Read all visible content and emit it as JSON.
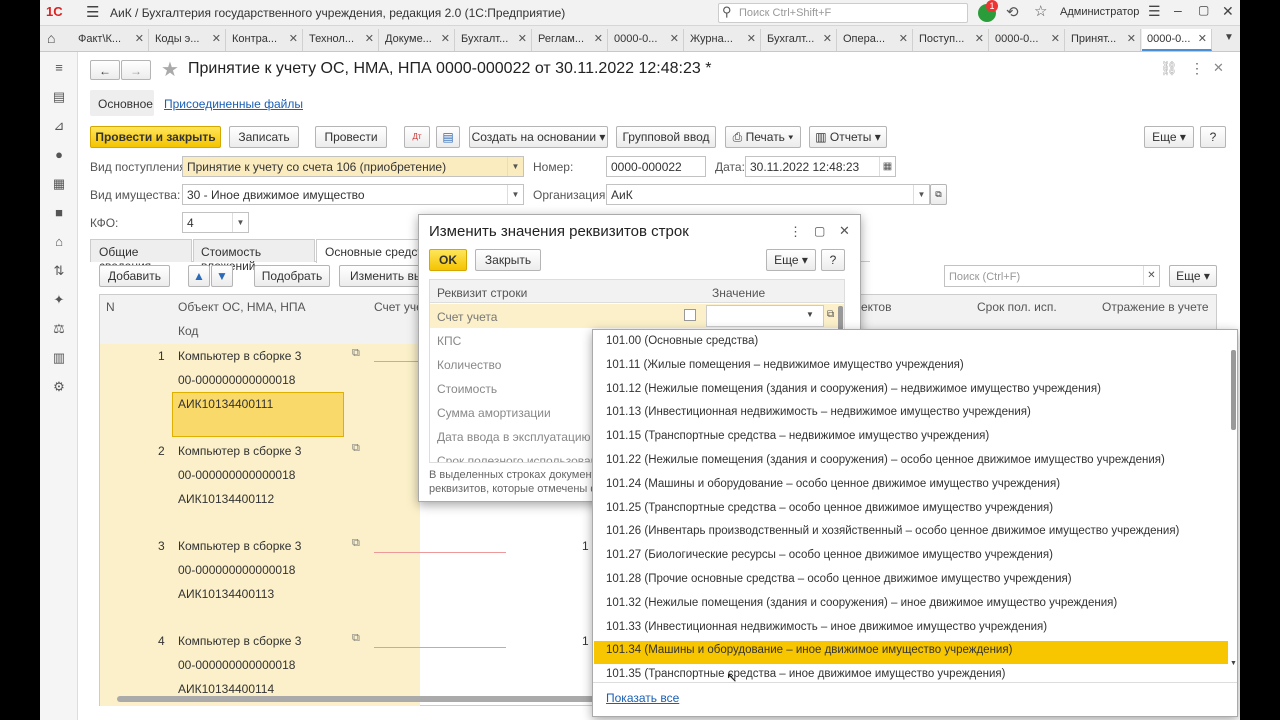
{
  "titlebar": {
    "logo": "1С",
    "menu_icon": "hamburger-icon",
    "title": "АиК / Бухгалтерия государственного учреждения, редакция 2.0  (1С:Предприятие)",
    "search_placeholder": "Поиск Ctrl+Shift+F",
    "notification_count": "1",
    "user": "Администратор"
  },
  "tabs": [
    "Факт\\К...",
    "Коды э...",
    "Контра...",
    "Технол...",
    "Докуме...",
    "Бухгалт...",
    "Реглам...",
    "0000-0...",
    "Журна...",
    "Бухгалт...",
    "Опера...",
    "Поступ...",
    "0000-0...",
    "Принят...",
    "0000-0..."
  ],
  "document": {
    "title": "Принятие к учету ОС, НМА, НПА 0000-000022 от 30.11.2022 12:48:23 *",
    "subtabs": [
      "Основное",
      "Присоединенные файлы"
    ],
    "toolbar": {
      "post_close": "Провести и закрыть",
      "write": "Записать",
      "post": "Провести",
      "create_based": "Создать на основании",
      "group_input": "Групповой ввод",
      "print": "Печать",
      "reports": "Отчеты",
      "more": "Еще",
      "help": "?"
    },
    "fields": {
      "receipt_type_label": "Вид поступления:",
      "receipt_type_value": "Принятие к учету со счета 106 (приобретение)",
      "number_label": "Номер:",
      "number_value": "0000-000022",
      "date_label": "Дата:",
      "date_value": "30.11.2022 12:48:23",
      "property_type_label": "Вид имущества:",
      "property_type_value": "30 - Иное движимое имущество",
      "org_label": "Организация:",
      "org_value": "АиК",
      "kfo_label": "КФО:",
      "kfo_value": "4"
    },
    "sections": [
      "Общие сведения",
      "Стоимость вложений",
      "Основные средства"
    ],
    "grid_toolbar": {
      "add": "Добавить",
      "pick": "Подобрать",
      "change": "Изменить выд",
      "search_placeholder": "Поиск (Ctrl+F)",
      "more": "Еще"
    },
    "grid_headers": {
      "n": "N",
      "object": "Объект ОС, НМА, НПА",
      "code": "Код",
      "account": "Счет уче",
      "objects": "ектов",
      "term": "Срок пол. исп.",
      "reflection": "Отражение в учете"
    },
    "rows": [
      {
        "n": "1",
        "name": "Компьютер в сборке 3",
        "code": "00-000000000000018",
        "inv": "АИК10134400111"
      },
      {
        "n": "2",
        "name": "Компьютер в сборке 3",
        "code": "00-000000000000018",
        "inv": "АИК10134400112"
      },
      {
        "n": "3",
        "name": "Компьютер в сборке 3",
        "code": "00-000000000000018",
        "inv": "АИК10134400113",
        "qty": "1"
      },
      {
        "n": "4",
        "name": "Компьютер в сборке 3",
        "code": "00-000000000000018",
        "inv": "АИК10134400114",
        "qty": "1"
      }
    ]
  },
  "dialog": {
    "title": "Изменить значения реквизитов строк",
    "ok": "OK",
    "close": "Закрыть",
    "more": "Еще",
    "help": "?",
    "col_requisite": "Реквизит строки",
    "col_value": "Значение",
    "requisites": [
      "Счет учета",
      "КПС",
      "Количество",
      "Стоимость",
      "Сумма амортизации",
      "Дата ввода в эксплуатацию",
      "Срок полезного использования"
    ],
    "note_line1": "В выделенных строках документ",
    "note_line2": "реквизитов, которые отмечены ф"
  },
  "account_dropdown": {
    "items": [
      "101.00 (Основные средства)",
      "101.11 (Жилые помещения – недвижимое имущество учреждения)",
      "101.12 (Нежилые помещения (здания и сооружения) – недвижимое имущество учреждения)",
      "101.13 (Инвестиционная недвижимость – недвижимое имущество учреждения)",
      "101.15 (Транспортные средства – недвижимое имущество учреждения)",
      "101.22 (Нежилые помещения (здания и сооружения) – особо ценное движимое имущество учреждения)",
      "101.24 (Машины и оборудование – особо ценное движимое имущество учреждения)",
      "101.25 (Транспортные средства – особо ценное движимое имущество учреждения)",
      "101.26 (Инвентарь производственный и хозяйственный – особо ценное движимое имущество учреждения)",
      "101.27 (Биологические ресурсы – особо ценное движимое имущество учреждения)",
      "101.28 (Прочие основные средства – особо ценное движимое имущество учреждения)",
      "101.32 (Нежилые помещения (здания и сооружения) – иное движимое имущество учреждения)",
      "101.33 (Инвестиционная недвижимость – иное движимое имущество учреждения)",
      "101.34 (Машины и оборудование – иное движимое имущество учреждения)",
      "101.35 (Транспортные средства – иное движимое имущество учреждения)"
    ],
    "selected_index": 13,
    "show_all": "Показать все"
  }
}
